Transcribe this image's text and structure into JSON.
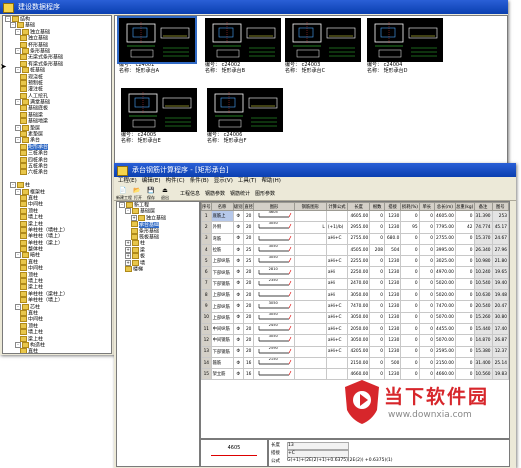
{
  "window1": {
    "title": "建设数据程序",
    "tree": [
      {
        "label": "结构",
        "level": 0,
        "exp": "-"
      },
      {
        "label": "基础",
        "level": 1,
        "exp": "-"
      },
      {
        "label": "独立基础",
        "level": 2,
        "exp": "-"
      },
      {
        "label": "独立基础",
        "level": 3
      },
      {
        "label": "杯形基础",
        "level": 3
      },
      {
        "label": "条形基础",
        "level": 2,
        "exp": "-"
      },
      {
        "label": "无梁式条形基础",
        "level": 3
      },
      {
        "label": "有梁式条形基础",
        "level": 3
      },
      {
        "label": "桩基础",
        "level": 2,
        "exp": "-"
      },
      {
        "label": "现浇桩",
        "level": 3
      },
      {
        "label": "预制桩",
        "level": 3
      },
      {
        "label": "灌注桩",
        "level": 3
      },
      {
        "label": "人工挖孔",
        "level": 3
      },
      {
        "label": "满堂基础",
        "level": 2,
        "exp": "-"
      },
      {
        "label": "基础底板",
        "level": 3
      },
      {
        "label": "基础梁",
        "level": 3
      },
      {
        "label": "基础地梁",
        "level": 3
      },
      {
        "label": "垫层",
        "level": 2,
        "exp": "-"
      },
      {
        "label": "素垫层",
        "level": 3
      },
      {
        "label": "承台",
        "level": 2,
        "exp": "-"
      },
      {
        "label": "矩形承台",
        "level": 3,
        "sel": true
      },
      {
        "label": "三桩承台",
        "level": 3
      },
      {
        "label": "四桩承台",
        "level": 3
      },
      {
        "label": "五桩承台",
        "level": 3
      },
      {
        "label": "六桩承台",
        "level": 3
      },
      {
        "label": "",
        "level": 0
      },
      {
        "label": "柱",
        "level": 1,
        "exp": "-"
      },
      {
        "label": "框架柱",
        "level": 2,
        "exp": "-"
      },
      {
        "label": "直柱",
        "level": 3
      },
      {
        "label": "中间柱",
        "level": 3
      },
      {
        "label": "顶柱",
        "level": 3
      },
      {
        "label": "墙上柱",
        "level": 3
      },
      {
        "label": "梁上柱",
        "level": 3
      },
      {
        "label": "单柱柱（墙柱上）",
        "level": 3
      },
      {
        "label": "单柱柱（墙上）",
        "level": 3
      },
      {
        "label": "单柱柱（梁上）",
        "level": 3
      },
      {
        "label": "整体柱",
        "level": 3
      },
      {
        "label": "暗柱",
        "level": 2,
        "exp": "-"
      },
      {
        "label": "直柱",
        "level": 3
      },
      {
        "label": "中间柱",
        "level": 3
      },
      {
        "label": "顶柱",
        "level": 3
      },
      {
        "label": "墙上柱",
        "level": 3
      },
      {
        "label": "梁上柱",
        "level": 3
      },
      {
        "label": "单柱柱（梁柱上）",
        "level": 3
      },
      {
        "label": "单柱柱（墙上）",
        "level": 3
      },
      {
        "label": "芯柱",
        "level": 2,
        "exp": "-"
      },
      {
        "label": "直柱",
        "level": 3
      },
      {
        "label": "中间柱",
        "level": 3
      },
      {
        "label": "顶柱",
        "level": 3
      },
      {
        "label": "墙上柱",
        "level": 3
      },
      {
        "label": "梁上柱",
        "level": 3
      },
      {
        "label": "构造柱",
        "level": 2,
        "exp": "-"
      },
      {
        "label": "直柱",
        "level": 3
      },
      {
        "label": "中间柱",
        "level": 3
      },
      {
        "label": "顶柱",
        "level": 3
      },
      {
        "label": "墙上柱",
        "level": 3
      },
      {
        "label": "梁上柱",
        "level": 3
      }
    ],
    "thumbnails": [
      {
        "code": "编号：   c24001",
        "name": "名称：  矩形承台A"
      },
      {
        "code": "编号：   c24002",
        "name": "名称：  矩形承台B"
      },
      {
        "code": "编号：   c24003",
        "name": "名称：  矩形承台C"
      },
      {
        "code": "编号：   c24004",
        "name": "名称：  矩形承台D"
      },
      {
        "code": "编号：   c24005",
        "name": "名称：  矩形承台E"
      },
      {
        "code": "编号：   c24006",
        "name": "名称：  矩形承台F"
      }
    ]
  },
  "window2": {
    "title": "承台钢筋计算程序 - [矩形承台]",
    "menu": [
      "工程(E)",
      "编辑(E)",
      "构件(C)",
      "条件(B)",
      "显示(V)",
      "工具(T)",
      "帮助(H)"
    ],
    "toolbar": [
      "新建工程",
      "打开",
      "保存",
      "退出"
    ],
    "tabs": [
      "工程信息",
      "钢筋参数",
      "钢筋统计",
      "图形参数"
    ],
    "tree": [
      {
        "label": "新工程",
        "level": 0,
        "exp": "-"
      },
      {
        "label": "基础层",
        "level": 1,
        "exp": "-"
      },
      {
        "label": "独立基础",
        "level": 2,
        "exp": "+"
      },
      {
        "label": "承台基础",
        "level": 2,
        "sel": true
      },
      {
        "label": "条形基础",
        "level": 2
      },
      {
        "label": "筏板基础",
        "level": 2
      },
      {
        "label": "柱",
        "level": 1,
        "exp": "+"
      },
      {
        "label": "梁",
        "level": 1,
        "exp": "+"
      },
      {
        "label": "板",
        "level": 1,
        "exp": "+"
      },
      {
        "label": "墙",
        "level": 1,
        "exp": "+"
      },
      {
        "label": "楼梯",
        "level": 1
      }
    ],
    "columns": [
      "序号",
      "名称",
      "级别",
      "直径",
      "图形",
      "钢筋图形",
      "计算公式",
      "长度",
      "根数",
      "搭接",
      "损耗(%)",
      "单长",
      "总长(m)",
      "总重(kg)",
      "备注",
      "图号"
    ],
    "rows": [
      {
        "n": "1",
        "name": "底筋上",
        "grade": "Φ",
        "dia": "20",
        "fig": "4605",
        "shape": "",
        "formula": "",
        "len": "4605.00",
        "count": "0",
        "lap": "1230",
        "loss": "0",
        "unit": "0",
        "total": "4605.00",
        "w1": "0",
        "w2": "31.390",
        "img": "253"
      },
      {
        "n": "2",
        "name": "外侧",
        "grade": "Φ",
        "dia": "20",
        "fig": "3050",
        "shape": "L",
        "formula": "(+1)/b(",
        "len": "2955.00",
        "count": "0",
        "lap": "1230",
        "loss": "95",
        "unit": "0",
        "total": "7795.00",
        "w1": "42",
        "w2": "74.774",
        "img": "45.17"
      },
      {
        "n": "3",
        "name": "弯筋",
        "grade": "Φ",
        "dia": "20",
        "fig": "",
        "shape": "",
        "formula": "aHi+C",
        "len": "2755.00",
        "count": "0",
        "lap": "680.0",
        "loss": "0",
        "unit": "0",
        "total": "2755.00",
        "w1": "0",
        "w2": "15.370",
        "img": "24.67"
      },
      {
        "n": "4",
        "name": "拉筋",
        "grade": "Φ",
        "dia": "25",
        "fig": "3050",
        "shape": "",
        "formula": "",
        "len": "4505.00",
        "count": "208",
        "lap": "504",
        "loss": "0",
        "unit": "0",
        "total": "3995.00",
        "w1": "0",
        "w2": "26.340",
        "img": "27.96"
      },
      {
        "n": "5",
        "name": "上部纵筋",
        "grade": "Φ",
        "dia": "25",
        "fig": "3050",
        "shape": "",
        "formula": "aHi+C",
        "len": "2255.00",
        "count": "0",
        "lap": "1230",
        "loss": "0",
        "unit": "0",
        "total": "3025.00",
        "w1": "0",
        "w2": "10.980",
        "img": "21.80"
      },
      {
        "n": "6",
        "name": "下部纵筋",
        "grade": "Φ",
        "dia": "20",
        "fig": "2810",
        "shape": "",
        "formula": "aHi",
        "len": "2250.00",
        "count": "0",
        "lap": "1230",
        "loss": "0",
        "unit": "0",
        "total": "4970.00",
        "w1": "0",
        "w2": "10.240",
        "img": "19.65"
      },
      {
        "n": "7",
        "name": "下部钢筋",
        "grade": "Φ",
        "dia": "20",
        "fig": "2350",
        "shape": "",
        "formula": "aHi",
        "len": "2470.00",
        "count": "0",
        "lap": "1230",
        "loss": "0",
        "unit": "0",
        "total": "5020.00",
        "w1": "0",
        "w2": "10.540",
        "img": "19.40"
      },
      {
        "n": "8",
        "name": "上部纵筋",
        "grade": "Φ",
        "dia": "20",
        "fig": "",
        "shape": "",
        "formula": "aHi",
        "len": "3050.00",
        "count": "0",
        "lap": "1230",
        "loss": "0",
        "unit": "0",
        "total": "5020.00",
        "w1": "0",
        "w2": "10.630",
        "img": "19.48"
      },
      {
        "n": "9",
        "name": "上部纵筋",
        "grade": "Φ",
        "dia": "20",
        "fig": "3050",
        "shape": "",
        "formula": "aHi+C",
        "len": "7470.00",
        "count": "0",
        "lap": "1230",
        "loss": "0",
        "unit": "0",
        "total": "7470.00",
        "w1": "0",
        "w2": "20.540",
        "img": "20.47"
      },
      {
        "n": "10",
        "name": "上部纵筋",
        "grade": "Φ",
        "dia": "20",
        "fig": "3050",
        "shape": "",
        "formula": "aHi+C",
        "len": "3050.00",
        "count": "0",
        "lap": "1230",
        "loss": "0",
        "unit": "0",
        "total": "5070.00",
        "w1": "0",
        "w2": "15.260",
        "img": "30.80"
      },
      {
        "n": "11",
        "name": "中间纵筋",
        "grade": "Φ",
        "dia": "20",
        "fig": "2450",
        "shape": "",
        "formula": "aHi+C",
        "len": "2050.00",
        "count": "0",
        "lap": "1230",
        "loss": "0",
        "unit": "0",
        "total": "4455.00",
        "w1": "0",
        "w2": "15.440",
        "img": "17.40"
      },
      {
        "n": "12",
        "name": "中间钢筋",
        "grade": "Φ",
        "dia": "20",
        "fig": "3050",
        "shape": "",
        "formula": "aHi+C",
        "len": "3050.00",
        "count": "0",
        "lap": "1230",
        "loss": "0",
        "unit": "0",
        "total": "5070.00",
        "w1": "0",
        "w2": "14.870",
        "img": "26.87"
      },
      {
        "n": "13",
        "name": "下部钢筋",
        "grade": "Φ",
        "dia": "20",
        "fig": "2590",
        "shape": "",
        "formula": "aHi+C",
        "len": "4205.00",
        "count": "0",
        "lap": "1230",
        "loss": "0",
        "unit": "0",
        "total": "2595.00",
        "w1": "0",
        "w2": "15.380",
        "img": "12.37"
      },
      {
        "n": "14",
        "name": "箍筋",
        "grade": "Φ",
        "dia": "16",
        "fig": "2150",
        "shape": "",
        "formula": "",
        "len": "2150.00",
        "count": "0",
        "lap": "500",
        "loss": "0",
        "unit": "0",
        "total": "2150.00",
        "w1": "0",
        "w2": "31.400",
        "img": "25.14"
      },
      {
        "n": "15",
        "name": "架立筋",
        "grade": "Φ",
        "dia": "16",
        "fig": "",
        "shape": "",
        "formula": "",
        "len": "4660.00",
        "count": "0",
        "lap": "1230",
        "loss": "0",
        "unit": "0",
        "total": "4660.00",
        "w1": "0",
        "w2": "10.560",
        "img": "19.83"
      }
    ],
    "preview_value": "4605",
    "info": {
      "label1": "长度",
      "val1": "13",
      "label2": "搭接",
      "val2": "+C",
      "label3": "公式",
      "formula": "G(+1)+(2E(2)+1)+0.6375)(2E(2)) +0.6375)(1)"
    }
  },
  "watermark": {
    "brand": "当下软件园",
    "url": "www.downxia.com"
  },
  "colors": {
    "titlebar": "#0a3fb0",
    "selection": "#316ac5",
    "cad_bg": "#000000",
    "window_bg": "#ece9d8",
    "logo_red": "#d7262b"
  }
}
